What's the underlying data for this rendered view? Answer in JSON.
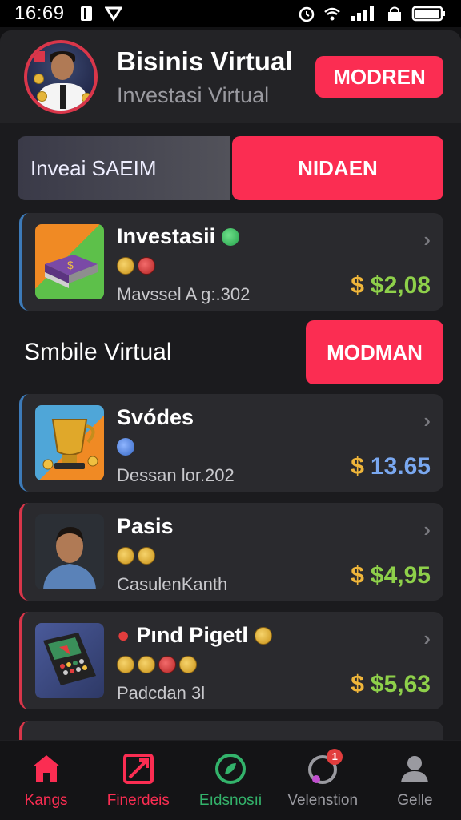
{
  "status": {
    "time": "16:69"
  },
  "header": {
    "title": "Bisinis Virtual",
    "subtitle": "Investasi Virtual",
    "button": "MODREN"
  },
  "segment": {
    "left": "Inveai SAEIM",
    "right": "NIDAEN"
  },
  "cards_top": [
    {
      "title": "Investasii",
      "subtitle": "Mavssel A g:.302",
      "price": "$2,08",
      "price_color": "#8ed04a"
    }
  ],
  "section": {
    "title": "Smbile Virtual",
    "button": "MODMAN"
  },
  "cards": [
    {
      "title": "Svódes",
      "subtitle": "Dessan lor.202",
      "price": "13.65",
      "price_color": "#7aa8f0"
    },
    {
      "title": "Pasis",
      "subtitle": "CasulenKanth",
      "price": "$4,95",
      "price_color": "#8ed04a"
    },
    {
      "title": "Pınd Pigetl",
      "subtitle": "Padcdan 3l",
      "price": "$5,63",
      "price_color": "#8ed04a"
    }
  ],
  "price_symbol": "$",
  "nav": [
    {
      "label": "Kangs",
      "icon": "home-icon",
      "color": "#fb2d52"
    },
    {
      "label": "Finerdeis",
      "icon": "chart-icon",
      "color": "#fb2d52"
    },
    {
      "label": "Eıdsnosıi",
      "icon": "growth-icon",
      "color": "#33b36b"
    },
    {
      "label": "Velenstion",
      "icon": "notification-icon",
      "color": "#9a9aa0",
      "badge": "1"
    },
    {
      "label": "Gelle",
      "icon": "profile-icon",
      "color": "#9a9aa0"
    }
  ]
}
